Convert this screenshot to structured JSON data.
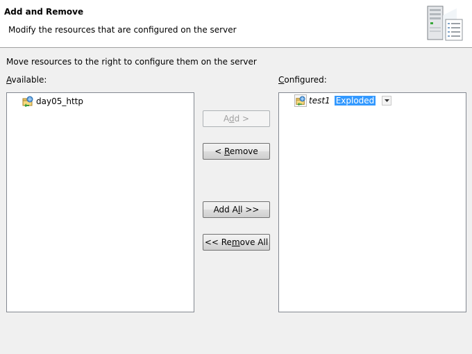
{
  "header": {
    "title": "Add and Remove",
    "description": "Modify the resources that are configured on the server",
    "icon": "server-icon"
  },
  "intro": "Move resources to the right to configure them on the server",
  "available": {
    "label_pre": "",
    "label_mn": "A",
    "label_post": "vailable:",
    "items": [
      {
        "label": "day05_http",
        "icon": "web-project-icon"
      }
    ]
  },
  "configured": {
    "label_pre": "",
    "label_mn": "C",
    "label_post": "onfigured:",
    "items": [
      {
        "label": "test1",
        "mode": "Exploded",
        "icon": "web-project-icon"
      }
    ]
  },
  "buttons": {
    "add": {
      "pre": "A",
      "mn": "d",
      "post": "d >",
      "enabled": false
    },
    "remove": {
      "pre": "< ",
      "mn": "R",
      "post": "emove",
      "enabled": true
    },
    "add_all": {
      "pre": "Add A",
      "mn": "l",
      "post": "l >>",
      "enabled": true
    },
    "remove_all": {
      "pre": "<< Re",
      "mn": "m",
      "post": "ove All",
      "enabled": true
    }
  }
}
